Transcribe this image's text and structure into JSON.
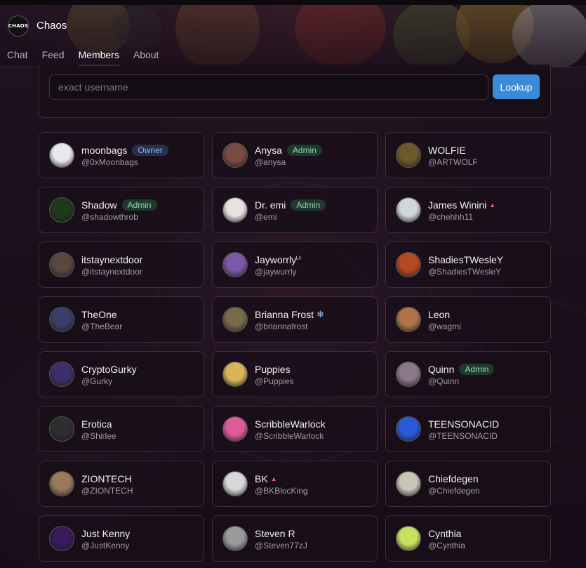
{
  "app": {
    "logo_text": "CHAOS",
    "title": "Chaos"
  },
  "tabs": [
    {
      "label": "Chat",
      "active": false
    },
    {
      "label": "Feed",
      "active": false
    },
    {
      "label": "Members",
      "active": true
    },
    {
      "label": "About",
      "active": false
    }
  ],
  "search": {
    "placeholder": "exact username",
    "value": "",
    "button_label": "Lookup"
  },
  "colors": {
    "accent": "#3b8ad6",
    "owner_badge": "#94b1e6",
    "admin_badge": "#8fd5a8"
  },
  "members": [
    {
      "name": "moonbags",
      "handle": "@0xMoonbags",
      "badge": "Owner",
      "avatar": "#e8e8ee"
    },
    {
      "name": "Anysa",
      "handle": "@anysa",
      "badge": "Admin",
      "avatar": "#7a4a45"
    },
    {
      "name": "WOLFIE",
      "handle": "@ARTWOLF",
      "badge": "",
      "avatar": "#6d5a2c"
    },
    {
      "name": "Shadow",
      "handle": "@shadowthrob",
      "badge": "Admin",
      "avatar": "#1f3a1a"
    },
    {
      "name": "Dr. emi",
      "handle": "@emi",
      "badge": "Admin",
      "avatar": "#e7e2df"
    },
    {
      "name": "James Winini",
      "handle": "@chehhh11",
      "badge": "",
      "flair": "▲",
      "avatar": "#cfd6dc"
    },
    {
      "name": "itstaynextdoor",
      "handle": "@itstaynextdoor",
      "badge": "",
      "avatar": "#5a4740"
    },
    {
      "name": "Jayworrly",
      "name_suffix": "ᴸ¹",
      "handle": "@jaywurrly",
      "badge": "",
      "avatar": "#7a5aa8"
    },
    {
      "name": "ShadiesTWesleY",
      "handle": "@ShadiesTWesleY",
      "badge": "",
      "avatar": "#b44a20"
    },
    {
      "name": "TheOne",
      "handle": "@TheBear",
      "badge": "",
      "avatar": "#3a3f6a"
    },
    {
      "name": "Brianna Frost",
      "handle": "@briannafrost",
      "badge": "",
      "flair": "❄",
      "avatar": "#7a6a4a"
    },
    {
      "name": "Leon",
      "handle": "@wagmi",
      "badge": "",
      "avatar": "#b0734a"
    },
    {
      "name": "CryptoGurky",
      "handle": "@Gurky",
      "badge": "",
      "avatar": "#3a2f6a"
    },
    {
      "name": "Puppies",
      "handle": "@Puppies",
      "badge": "",
      "avatar": "#d9b45a"
    },
    {
      "name": "Quinn",
      "handle": "@Quinn",
      "badge": "Admin",
      "avatar": "#8a7a8a"
    },
    {
      "name": "Erotica",
      "handle": "@Shirlee",
      "badge": "",
      "avatar": "#2e2e2e"
    },
    {
      "name": "ScribbleWarlock",
      "handle": "@ScribbleWarlock",
      "badge": "",
      "avatar": "#e05a9a"
    },
    {
      "name": "TEENSONACID",
      "handle": "@TEENSONACID",
      "badge": "",
      "avatar": "#2a5ad8"
    },
    {
      "name": "ZIONTECH",
      "handle": "@ZIONTECH",
      "badge": "",
      "avatar": "#9a7a5a"
    },
    {
      "name": "BK",
      "handle": "@BKBlocKing",
      "badge": "",
      "flair": "▲",
      "avatar": "#d8d8d8"
    },
    {
      "name": "Chiefdegen",
      "handle": "@Chiefdegen",
      "badge": "",
      "avatar": "#c8c4b8"
    },
    {
      "name": "Just Kenny",
      "handle": "@JustKenny",
      "badge": "",
      "avatar": "#3a1a5a"
    },
    {
      "name": "Steven R",
      "handle": "@Steven77zJ",
      "badge": "",
      "avatar": "#9a9a9a"
    },
    {
      "name": "Cynthia",
      "handle": "@Cynthia",
      "badge": "",
      "avatar": "#c8e060"
    }
  ]
}
